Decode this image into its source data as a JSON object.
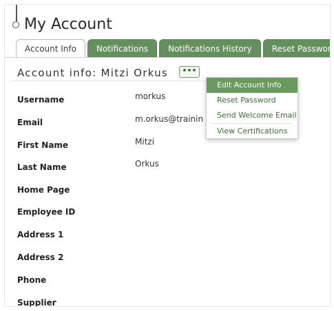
{
  "page": {
    "title": "My Account"
  },
  "tabs": [
    {
      "label": "Account Info",
      "active": true
    },
    {
      "label": "Notifications",
      "active": false
    },
    {
      "label": "Notifications History",
      "active": false
    },
    {
      "label": "Reset Password",
      "active": false
    }
  ],
  "section": {
    "header": "Account info: Mitzi Orkus",
    "more_button_label": "•••"
  },
  "fields": [
    {
      "label": "Username",
      "value": "morkus"
    },
    {
      "label": "Email",
      "value": "m.orkus@trainin"
    },
    {
      "label": "First Name",
      "value": "Mitzi"
    },
    {
      "label": "Last Name",
      "value": "Orkus"
    },
    {
      "label": "Home Page",
      "value": ""
    },
    {
      "label": "Employee ID",
      "value": ""
    },
    {
      "label": "Address 1",
      "value": ""
    },
    {
      "label": "Address 2",
      "value": ""
    },
    {
      "label": "Phone",
      "value": ""
    },
    {
      "label": "Supplier",
      "value": ""
    }
  ],
  "menu": {
    "items": [
      {
        "label": "Edit Account Info",
        "selected": true
      },
      {
        "label": "Reset Password",
        "selected": false
      },
      {
        "label": "Send Welcome Email",
        "selected": false
      },
      {
        "label": "View Certifications",
        "selected": false
      }
    ]
  },
  "colors": {
    "tab_green": "#63905c",
    "menu_highlight": "#6a9a5f",
    "link_green": "#3f6a38"
  }
}
